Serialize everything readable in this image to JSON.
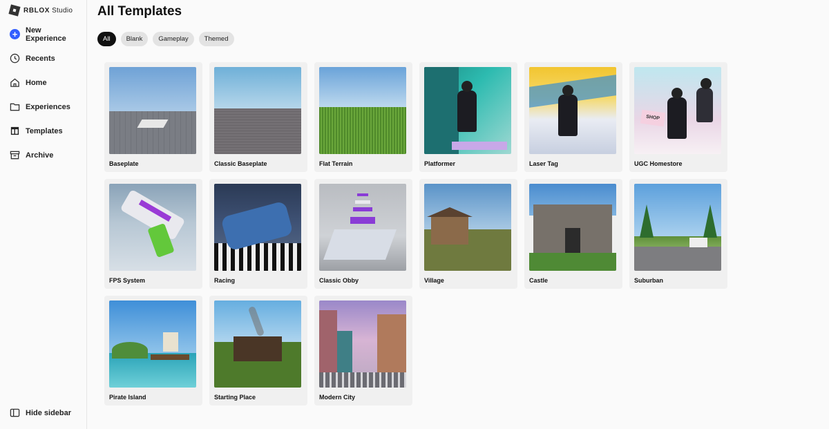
{
  "app": {
    "brand_bold": "RBLOX",
    "brand_rest": " Studio"
  },
  "sidebar": {
    "items": [
      {
        "label": "New Experience",
        "icon": "plus-circle-icon"
      },
      {
        "label": "Recents",
        "icon": "clock-icon"
      },
      {
        "label": "Home",
        "icon": "home-icon"
      },
      {
        "label": "Experiences",
        "icon": "folder-icon"
      },
      {
        "label": "Templates",
        "icon": "templates-icon"
      },
      {
        "label": "Archive",
        "icon": "archive-icon"
      }
    ],
    "hide_label": "Hide sidebar"
  },
  "main": {
    "title": "All Templates",
    "filters": [
      {
        "label": "All",
        "active": true
      },
      {
        "label": "Blank",
        "active": false
      },
      {
        "label": "Gameplay",
        "active": false
      },
      {
        "label": "Themed",
        "active": false
      }
    ],
    "templates": [
      {
        "name": "Baseplate"
      },
      {
        "name": "Classic Baseplate"
      },
      {
        "name": "Flat Terrain"
      },
      {
        "name": "Platformer"
      },
      {
        "name": "Laser Tag"
      },
      {
        "name": "UGC Homestore"
      },
      {
        "name": "FPS System"
      },
      {
        "name": "Racing"
      },
      {
        "name": "Classic Obby"
      },
      {
        "name": "Village"
      },
      {
        "name": "Castle"
      },
      {
        "name": "Suburban"
      },
      {
        "name": "Pirate Island"
      },
      {
        "name": "Starting Place"
      },
      {
        "name": "Modern City"
      }
    ],
    "shop_sign": "SHOP"
  },
  "colors": {
    "accent": "#335fff",
    "active_chip": "#111111",
    "chip": "#e3e3e3"
  }
}
